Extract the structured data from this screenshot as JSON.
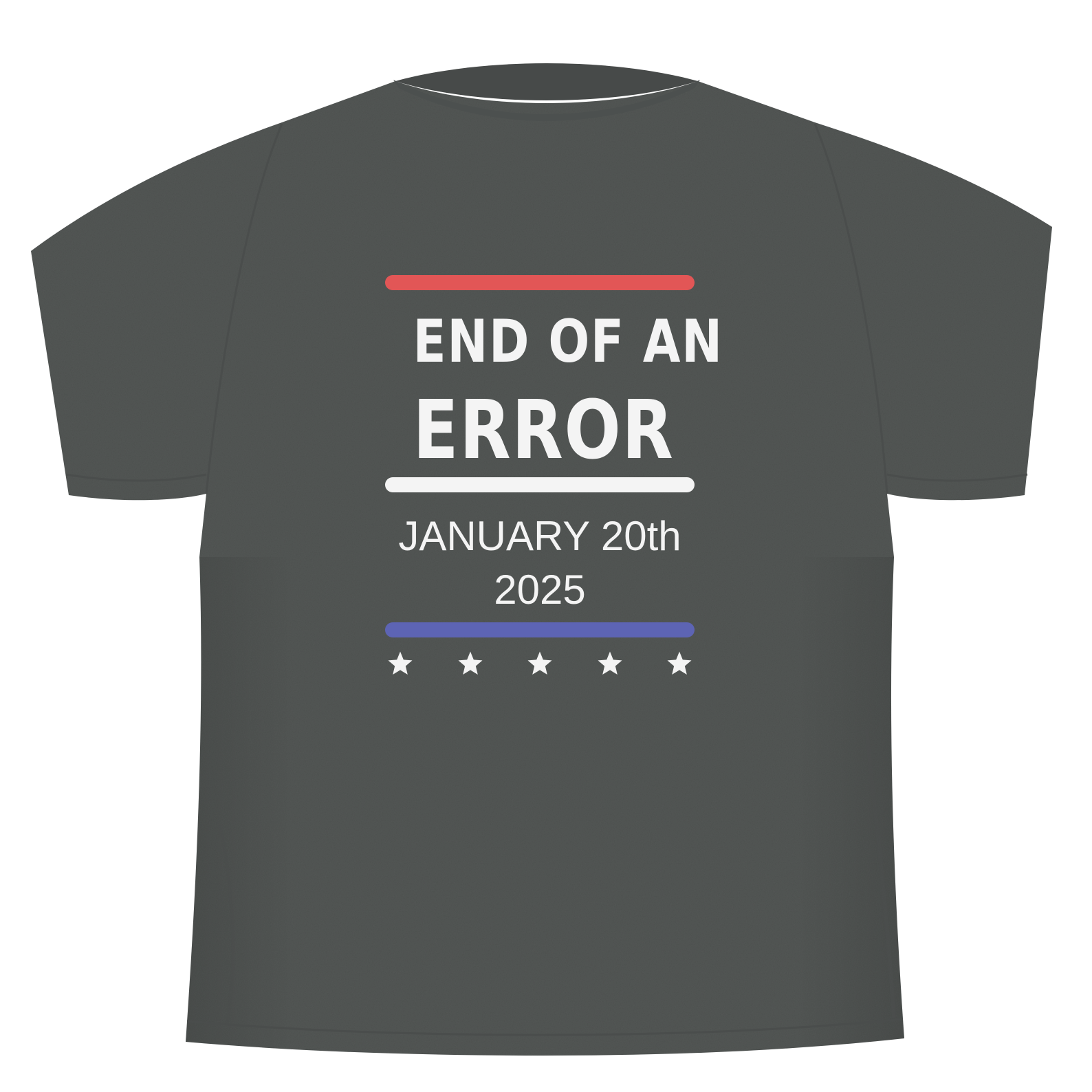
{
  "shirt": {
    "color": "#545857",
    "shadow_color": "#474a49",
    "highlight_color": "#5f6362"
  },
  "design": {
    "stripes": {
      "top_color": "#e25656",
      "middle_color": "#f4f4f4",
      "bottom_color": "#5d64b4"
    },
    "headline": {
      "line1": "END OF AN",
      "line2": "ERROR"
    },
    "date": {
      "line1": "JANUARY 20th",
      "line2": "2025"
    },
    "stars": {
      "count": 5,
      "icon": "star-icon",
      "color": "#f4f4f4"
    }
  }
}
